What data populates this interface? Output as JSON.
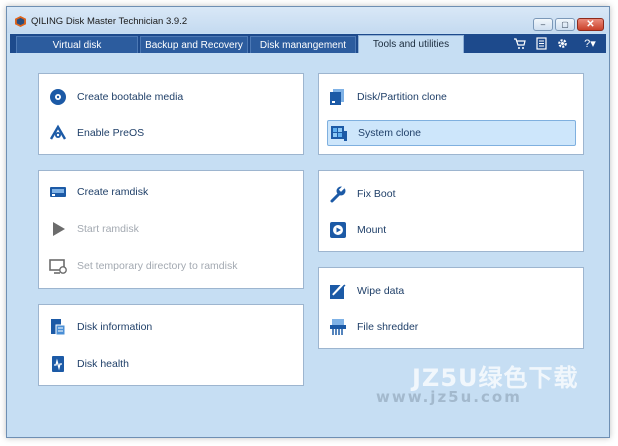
{
  "window": {
    "title": "QILING Disk Master Technician 3.9.2",
    "controls": {
      "minimize": "–",
      "maximize": "▢",
      "close": "✕"
    }
  },
  "tabs": [
    {
      "label": "Virtual disk",
      "active": false
    },
    {
      "label": "Backup and Recovery",
      "active": false
    },
    {
      "label": "Disk manangement",
      "active": false
    },
    {
      "label": "Tools and utilities",
      "active": true
    }
  ],
  "toolbar_icons": [
    "cart-icon",
    "document-icon",
    "gear-icon",
    "help-icon"
  ],
  "help_dropdown": "?▾",
  "panels": {
    "boot": [
      {
        "label": "Create bootable media",
        "icon": "bootable-media-icon",
        "enabled": true
      },
      {
        "label": "Enable PreOS",
        "icon": "preos-icon",
        "enabled": true
      }
    ],
    "ramdisk": [
      {
        "label": "Create ramdisk",
        "icon": "ramdisk-icon",
        "enabled": true
      },
      {
        "label": "Start ramdisk",
        "icon": "play-icon",
        "enabled": false
      },
      {
        "label": "Set temporary directory to ramdisk",
        "icon": "temp-directory-icon",
        "enabled": false
      }
    ],
    "disk_info": [
      {
        "label": "Disk information",
        "icon": "disk-information-icon",
        "enabled": true
      },
      {
        "label": "Disk health",
        "icon": "disk-health-icon",
        "enabled": true
      }
    ],
    "clone": [
      {
        "label": "Disk/Partition clone",
        "icon": "disk-clone-icon",
        "enabled": true
      },
      {
        "label": "System clone",
        "icon": "system-clone-icon",
        "enabled": true,
        "highlighted": true
      }
    ],
    "fix": [
      {
        "label": "Fix Boot",
        "icon": "wrench-icon",
        "enabled": true
      },
      {
        "label": "Mount",
        "icon": "mount-icon",
        "enabled": true
      }
    ],
    "wipe": [
      {
        "label": "Wipe data",
        "icon": "wipe-icon",
        "enabled": true
      },
      {
        "label": "File shredder",
        "icon": "shredder-icon",
        "enabled": true
      }
    ]
  },
  "watermark": {
    "text": "JZ5U绿色下载",
    "sub": "www.jz5u.com"
  },
  "colors": {
    "accent": "#1d4a8c",
    "background": "#c6def3",
    "text": "#1f3f68",
    "disabled": "#a3a9b1",
    "highlight": "#cde6fb"
  }
}
